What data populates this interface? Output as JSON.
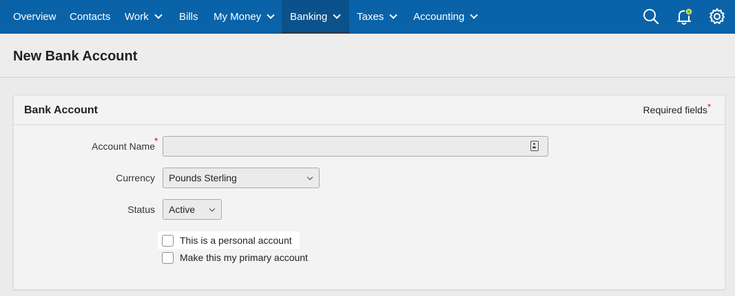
{
  "nav": {
    "items": [
      {
        "label": "Overview",
        "dropdown": false
      },
      {
        "label": "Contacts",
        "dropdown": false
      },
      {
        "label": "Work",
        "dropdown": true
      },
      {
        "label": "Bills",
        "dropdown": false
      },
      {
        "label": "My Money",
        "dropdown": true
      },
      {
        "label": "Banking",
        "dropdown": true,
        "active": true
      },
      {
        "label": "Taxes",
        "dropdown": true
      },
      {
        "label": "Accounting",
        "dropdown": true
      }
    ],
    "icons": [
      "search-icon",
      "notification-bell-icon",
      "settings-gear-icon"
    ],
    "colors": {
      "bar": "#0a63a8",
      "active": "#0b528c",
      "bell_badge": "#d4e157"
    }
  },
  "page": {
    "title": "New Bank Account"
  },
  "form": {
    "panel_title": "Bank Account",
    "required_note": "Required fields",
    "required_marker": "*",
    "account_name": {
      "label": "Account Name",
      "value": "",
      "placeholder": ""
    },
    "currency": {
      "label": "Currency",
      "selected": "Pounds Sterling"
    },
    "status": {
      "label": "Status",
      "selected": "Active"
    },
    "personal_checkbox": {
      "label": "This is a personal account",
      "checked": false
    },
    "primary_checkbox": {
      "label": "Make this my primary account",
      "checked": false
    }
  }
}
